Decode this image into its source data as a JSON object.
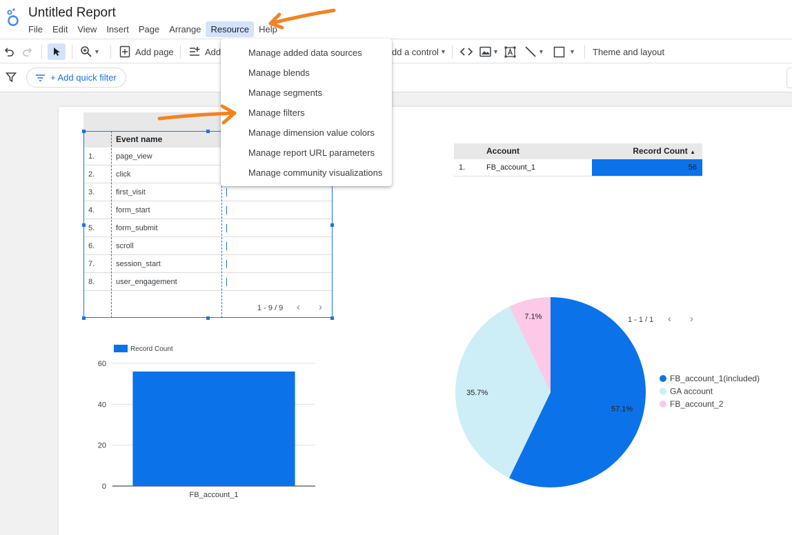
{
  "header": {
    "title": "Untitled Report",
    "menu": [
      "File",
      "Edit",
      "View",
      "Insert",
      "Page",
      "Arrange",
      "Resource",
      "Help"
    ],
    "active_menu": "Resource"
  },
  "toolbar": {
    "add_page": "Add page",
    "add_data": "Add",
    "add_control": "dd a control",
    "theme_layout": "Theme and layout"
  },
  "filterbar": {
    "quick_filter": "+ Add quick filter"
  },
  "resource_menu": {
    "items": [
      "Manage added data sources",
      "Manage blends",
      "Manage segments",
      "Manage filters",
      "Manage dimension value colors",
      "Manage report URL parameters",
      "Manage community visualizations"
    ]
  },
  "event_table": {
    "column": "Event name",
    "rows": [
      {
        "n": "1.",
        "name": "page_view"
      },
      {
        "n": "2.",
        "name": "click"
      },
      {
        "n": "3.",
        "name": "first_visit"
      },
      {
        "n": "4.",
        "name": "form_start"
      },
      {
        "n": "5.",
        "name": "form_submit"
      },
      {
        "n": "6.",
        "name": "scroll"
      },
      {
        "n": "7.",
        "name": "session_start"
      },
      {
        "n": "8.",
        "name": "user_engagement"
      }
    ],
    "pager": "1 - 9 / 9"
  },
  "account_table": {
    "col_account": "Account",
    "col_count": "Record Count",
    "sort_indicator": "▲",
    "rows": [
      {
        "n": "1.",
        "account": "FB_account_1",
        "value": "56"
      }
    ]
  },
  "pie_pager": "1 - 1 / 1",
  "colors": {
    "primary": "#0b72ea",
    "light_blue": "#cdeef6",
    "pink": "#fcc9e8",
    "accent_orange": "#f4831f"
  },
  "chart_data": [
    {
      "type": "bar",
      "legend": "Record Count",
      "categories": [
        "FB_account_1"
      ],
      "values": [
        56
      ],
      "ylim": [
        0,
        60
      ],
      "yticks": [
        "0",
        "20",
        "40",
        "60"
      ],
      "grid": true,
      "legend_position": "top-left"
    },
    {
      "type": "pie",
      "slices": [
        {
          "label": "FB_account_1(included)",
          "value": 57.1,
          "display": "57.1%",
          "color": "#0b72ea"
        },
        {
          "label": "GA account",
          "value": 35.7,
          "display": "35.7%",
          "color": "#cdeef6"
        },
        {
          "label": "FB_account_2",
          "value": 7.1,
          "display": "7.1%",
          "color": "#fcc9e8"
        }
      ],
      "legend_position": "right"
    }
  ]
}
